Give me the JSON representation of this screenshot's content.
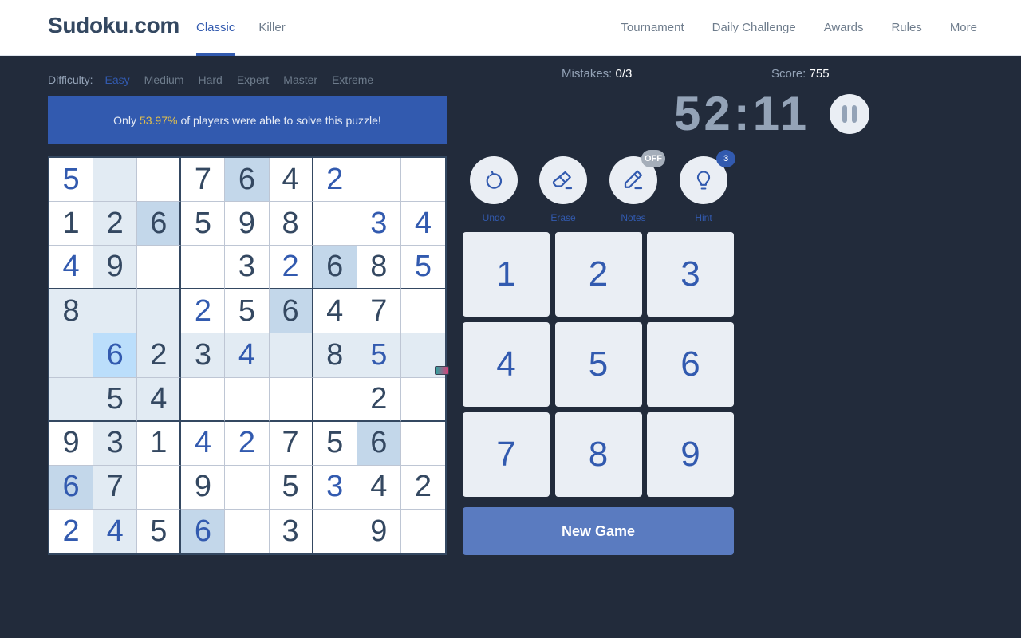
{
  "header": {
    "logo": "Sudoku.com",
    "nav_left": [
      {
        "label": "Classic",
        "active": true
      },
      {
        "label": "Killer",
        "active": false
      }
    ],
    "nav_right": [
      {
        "label": "Tournament"
      },
      {
        "label": "Daily Challenge"
      },
      {
        "label": "Awards"
      },
      {
        "label": "Rules"
      },
      {
        "label": "More"
      }
    ]
  },
  "difficulty": {
    "label": "Difficulty:",
    "options": [
      "Easy",
      "Medium",
      "Hard",
      "Expert",
      "Master",
      "Extreme"
    ],
    "selected": "Easy"
  },
  "banner": {
    "prefix": "Only",
    "percent": "53.97%",
    "suffix": "of players were able to solve this puzzle!"
  },
  "stats": {
    "mistakes_label": "Mistakes:",
    "mistakes_value": "0/3",
    "score_label": "Score:",
    "score_value": "755",
    "timer": "52:11"
  },
  "tools": [
    {
      "label": "Undo",
      "icon": "undo-icon"
    },
    {
      "label": "Erase",
      "icon": "eraser-icon"
    },
    {
      "label": "Notes",
      "icon": "pencil-icon",
      "badge": "OFF"
    },
    {
      "label": "Hint",
      "icon": "lightbulb-icon",
      "badge": "3"
    }
  ],
  "numpad": [
    "1",
    "2",
    "3",
    "4",
    "5",
    "6",
    "7",
    "8",
    "9"
  ],
  "new_game_label": "New Game",
  "board": {
    "selected": [
      4,
      1
    ],
    "cells": [
      [
        "5u",
        "",
        "",
        "7",
        "6",
        "4",
        "2u",
        "",
        ""
      ],
      [
        "1",
        "2",
        "6",
        "5",
        "9",
        "8",
        "",
        "3u",
        "4u"
      ],
      [
        "4u",
        "9",
        "",
        "",
        "3",
        "2u",
        "6",
        "8",
        "5u"
      ],
      [
        "8",
        "",
        "",
        "2u",
        "5",
        "6",
        "4",
        "7",
        ""
      ],
      [
        "",
        "6u",
        "2",
        "3",
        "4u",
        "",
        "8",
        "5u",
        ""
      ],
      [
        "",
        "5",
        "4",
        "",
        "",
        "",
        "",
        "2",
        ""
      ],
      [
        "9",
        "3",
        "1",
        "4u",
        "2u",
        "7",
        "5",
        "6",
        ""
      ],
      [
        "6u",
        "7",
        "",
        "9",
        "",
        "5",
        "3u",
        "4",
        "2"
      ],
      [
        "2u",
        "4u",
        "5",
        "6u",
        "",
        "3",
        "",
        "9",
        ""
      ]
    ]
  }
}
